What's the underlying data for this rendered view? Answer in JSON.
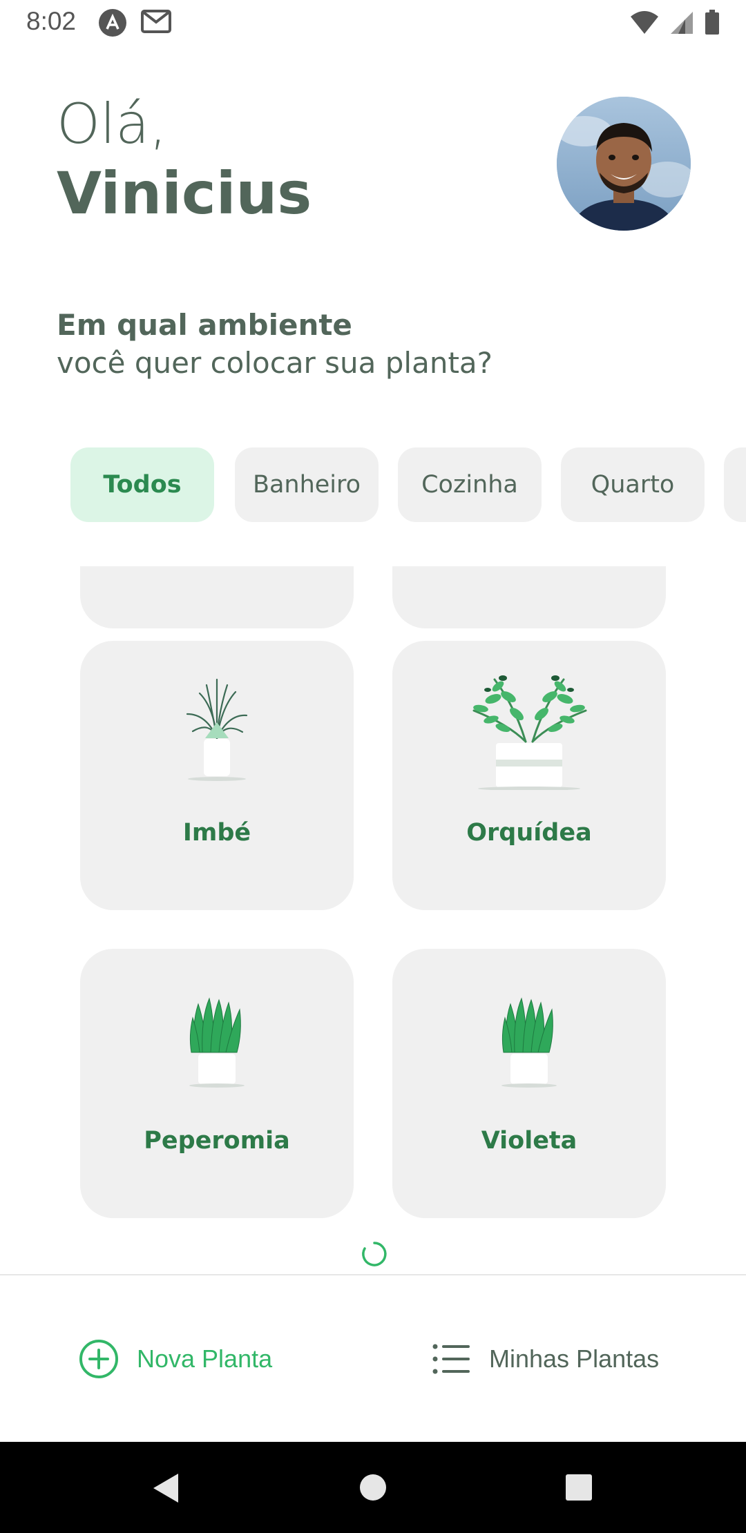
{
  "status_bar": {
    "time": "8:02",
    "left_icons": [
      "app-notification-icon",
      "gmail-icon"
    ],
    "right_icons": [
      "wifi-icon",
      "cell-signal-icon",
      "battery-icon"
    ]
  },
  "header": {
    "greeting": "Olá,",
    "user_name": "Vinicius",
    "avatar": "user-avatar"
  },
  "prompt": {
    "title": "Em qual ambiente",
    "subtitle": "você quer colocar sua planta?"
  },
  "environments": [
    {
      "label": "Todos",
      "active": true
    },
    {
      "label": "Banheiro",
      "active": false
    },
    {
      "label": "Cozinha",
      "active": false
    },
    {
      "label": "Quarto",
      "active": false
    }
  ],
  "plants": [
    {
      "name": "Imbé",
      "icon": "imbe-plant-icon"
    },
    {
      "name": "Orquídea",
      "icon": "orquidea-plant-icon"
    },
    {
      "name": "Peperomia",
      "icon": "peperomia-plant-icon"
    },
    {
      "name": "Violeta",
      "icon": "violeta-plant-icon"
    }
  ],
  "loading": true,
  "bottom_nav": {
    "new_plant": "Nova Planta",
    "my_plants": "Minhas Plantas"
  },
  "colors": {
    "primary_green": "#32B768",
    "heading": "#52665A",
    "card_background": "#F0F0F0",
    "chip_active_background": "#DCF5E6"
  }
}
